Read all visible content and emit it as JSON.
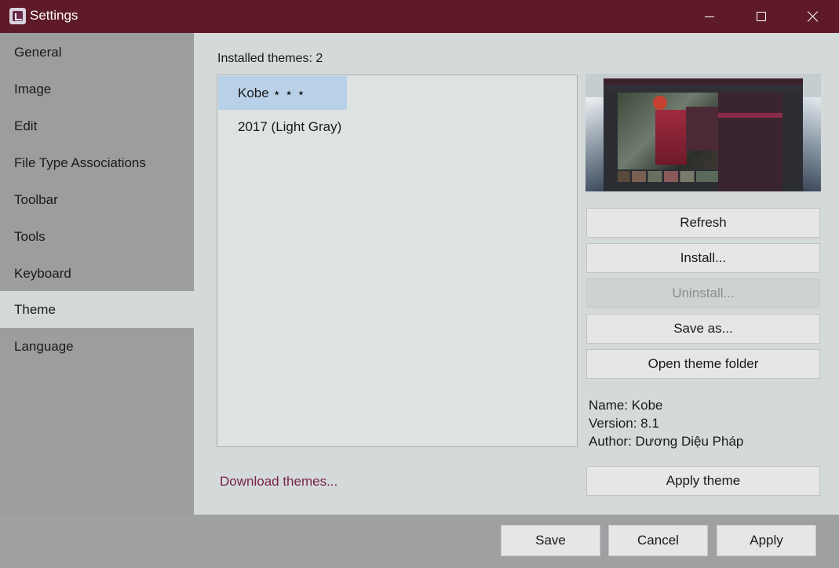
{
  "window": {
    "title": "Settings",
    "icons": {
      "app": "imageglass-app-icon",
      "minimize": "minimize-icon",
      "maximize": "maximize-icon",
      "close": "close-icon"
    }
  },
  "sidebar": {
    "items": [
      {
        "label": "General"
      },
      {
        "label": "Image"
      },
      {
        "label": "Edit"
      },
      {
        "label": "File Type Associations"
      },
      {
        "label": "Toolbar"
      },
      {
        "label": "Tools"
      },
      {
        "label": "Keyboard"
      },
      {
        "label": "Theme",
        "active": true
      },
      {
        "label": "Language"
      }
    ]
  },
  "theme_panel": {
    "installed_label": "Installed themes: 2",
    "themes": [
      {
        "name": "Kobe ⋆ ⋆ ⋆",
        "selected": true
      },
      {
        "name": "2017 (Light Gray)"
      }
    ],
    "download_link": "Download themes...",
    "buttons": {
      "refresh": "Refresh",
      "install": "Install...",
      "uninstall": "Uninstall...",
      "save_as": "Save as...",
      "open_folder": "Open theme folder",
      "apply_theme": "Apply theme"
    },
    "info": {
      "name": "Name: Kobe",
      "version": "Version: 8.1",
      "author": "Author: Dương Diệu Pháp"
    }
  },
  "footer": {
    "save": "Save",
    "cancel": "Cancel",
    "apply": "Apply"
  },
  "colors": {
    "titlebar": "#5e1b27",
    "link": "#7a2348",
    "selection": "#b9d1e8"
  }
}
